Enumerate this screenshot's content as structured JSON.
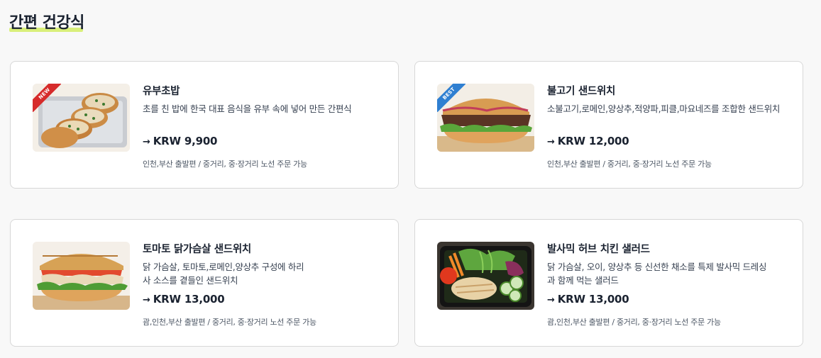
{
  "section": {
    "title": "간편 건강식"
  },
  "colors": {
    "new_badge": "#d62b2b",
    "best_badge": "#2f7fd1",
    "highlight": "#d9ef7a"
  },
  "products": [
    {
      "name": "유부초밥",
      "description": "초를 친 밥에 한국 대표 음식을 유부 속에 넣어 만든 간편식",
      "price_arrow": "→",
      "price": "KRW 9,900",
      "route": "인천,부산 출발편 / 중거리, 중·장거리 노선 주문 가능",
      "badge": "NEW",
      "image_icon": "inari-sushi-photo"
    },
    {
      "name": "불고기 샌드위치",
      "description": "소불고기,로메인,양상추,적양파,피클,마요네즈를 조합한 샌드위치",
      "price_arrow": "→",
      "price": "KRW 12,000",
      "route": "인천,부산 출발편 / 중거리, 중·장거리 노선 주문 가능",
      "badge": "BEST",
      "image_icon": "bulgogi-sandwich-photo"
    },
    {
      "name": "토마토 닭가슴살 샌드위치",
      "description": "닭 가슴살, 토마토,로메인,양상추 구성에 하리사 소스를 곁들인 샌드위치",
      "price_arrow": "→",
      "price": "KRW 13,000",
      "route": "괌,인천,부산 출발편 / 중거리, 중·장거리 노선 주문 가능",
      "badge": "",
      "image_icon": "chicken-tomato-sandwich-photo"
    },
    {
      "name": "발사믹 허브 치킨 샐러드",
      "description": "닭 가슴살, 오이, 양상추 등 신선한 채소를 특제 발사믹 드레싱과 함께 먹는 샐러드",
      "price_arrow": "→",
      "price": "KRW 13,000",
      "route": "괌,인천,부산 출발편 / 중거리, 중·장거리 노선 주문 가능",
      "badge": "",
      "image_icon": "chicken-salad-photo"
    }
  ]
}
